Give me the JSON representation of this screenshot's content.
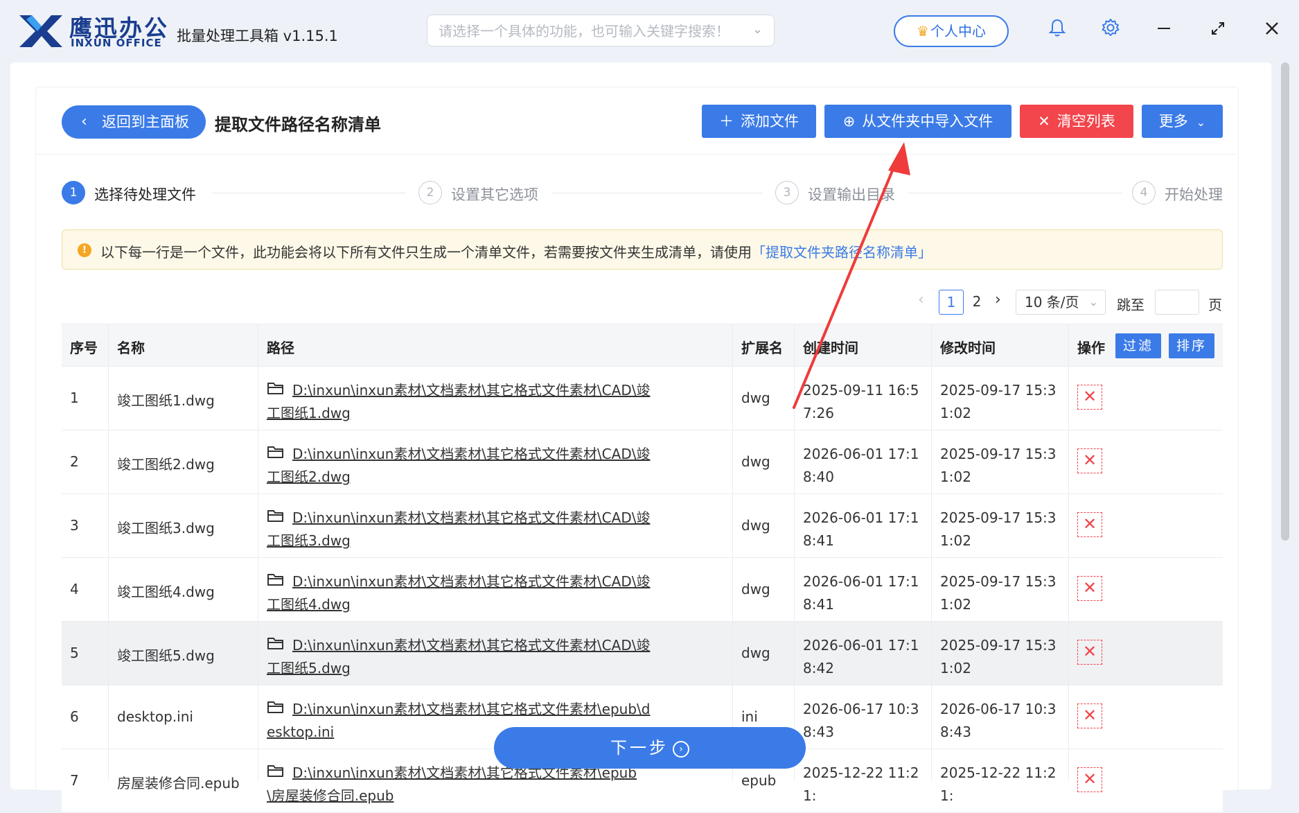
{
  "app": {
    "brand_cn": "鹰迅办公",
    "brand_en": "INXUN OFFICE",
    "title": "批量处理工具箱 v1.15.1",
    "search_placeholder": "请选择一个具体的功能，也可输入关键字搜索！",
    "user_center": "个人中心",
    "icons": [
      "bell-icon",
      "gear-icon",
      "minimize-icon",
      "maximize-icon",
      "close-icon"
    ],
    "accent_color": "#3b7be8",
    "danger_color": "#f2454c"
  },
  "toolbar": {
    "back_label": "返回到主面板",
    "page_title": "提取文件路径名称清单",
    "add_file": "添加文件",
    "import_folder": "从文件夹中导入文件",
    "clear_list": "清空列表",
    "more": "更多"
  },
  "steps": [
    {
      "num": "1",
      "label": "选择待处理文件",
      "active": true
    },
    {
      "num": "2",
      "label": "设置其它选项",
      "active": false
    },
    {
      "num": "3",
      "label": "设置输出目录",
      "active": false
    },
    {
      "num": "4",
      "label": "开始处理",
      "active": false
    }
  ],
  "notice": {
    "text": "以下每一行是一个文件，此功能会将以下所有文件只生成一个清单文件，若需要按文件夹生成清单，请使用",
    "link": "「提取文件夹路径名称清单」"
  },
  "pagination": {
    "pages": [
      "1",
      "2"
    ],
    "current": "1",
    "page_size": "10 条/页",
    "goto_label": "跳至",
    "page_suffix": "页"
  },
  "table": {
    "headers": {
      "index": "序号",
      "name": "名称",
      "path": "路径",
      "ext": "扩展名",
      "created": "创建时间",
      "modified": "修改时间",
      "action": "操作",
      "filter": "过滤",
      "sort": "排序"
    },
    "rows": [
      {
        "index": "1",
        "name": "竣工图纸1.dwg",
        "path": "D:\\inxun\\inxun素材\\文档素材\\其它格式文件素材\\CAD\\竣工图纸1.dwg",
        "ext": "dwg",
        "created": "2025-09-11 16:57:26",
        "modified": "2025-09-17 15:31:02"
      },
      {
        "index": "2",
        "name": "竣工图纸2.dwg",
        "path": "D:\\inxun\\inxun素材\\文档素材\\其它格式文件素材\\CAD\\竣工图纸2.dwg",
        "ext": "dwg",
        "created": "2026-06-01 17:18:40",
        "modified": "2025-09-17 15:31:02"
      },
      {
        "index": "3",
        "name": "竣工图纸3.dwg",
        "path": "D:\\inxun\\inxun素材\\文档素材\\其它格式文件素材\\CAD\\竣工图纸3.dwg",
        "ext": "dwg",
        "created": "2026-06-01 17:18:41",
        "modified": "2025-09-17 15:31:02"
      },
      {
        "index": "4",
        "name": "竣工图纸4.dwg",
        "path": "D:\\inxun\\inxun素材\\文档素材\\其它格式文件素材\\CAD\\竣工图纸4.dwg",
        "ext": "dwg",
        "created": "2026-06-01 17:18:41",
        "modified": "2025-09-17 15:31:02"
      },
      {
        "index": "5",
        "name": "竣工图纸5.dwg",
        "path": "D:\\inxun\\inxun素材\\文档素材\\其它格式文件素材\\CAD\\竣工图纸5.dwg",
        "ext": "dwg",
        "created": "2026-06-01 17:18:42",
        "modified": "2025-09-17 15:31:02",
        "highlight": true
      },
      {
        "index": "6",
        "name": "desktop.ini",
        "path": "D:\\inxun\\inxun素材\\文档素材\\其它格式文件素材\\epub\\desktop.ini",
        "ext": "ini",
        "created": "2026-06-17 10:38:43",
        "modified": "2026-06-17 10:38:43"
      },
      {
        "index": "7",
        "name": "房屋装修合同.epub",
        "path": "D:\\inxun\\inxun素材\\文档素材\\其它格式文件素材\\epub\\房屋装修合同.epub",
        "ext": "epub",
        "created": "2025-12-22 11:21:",
        "modified": "2025-12-22 11:21:"
      }
    ]
  },
  "next_button": "下一步"
}
